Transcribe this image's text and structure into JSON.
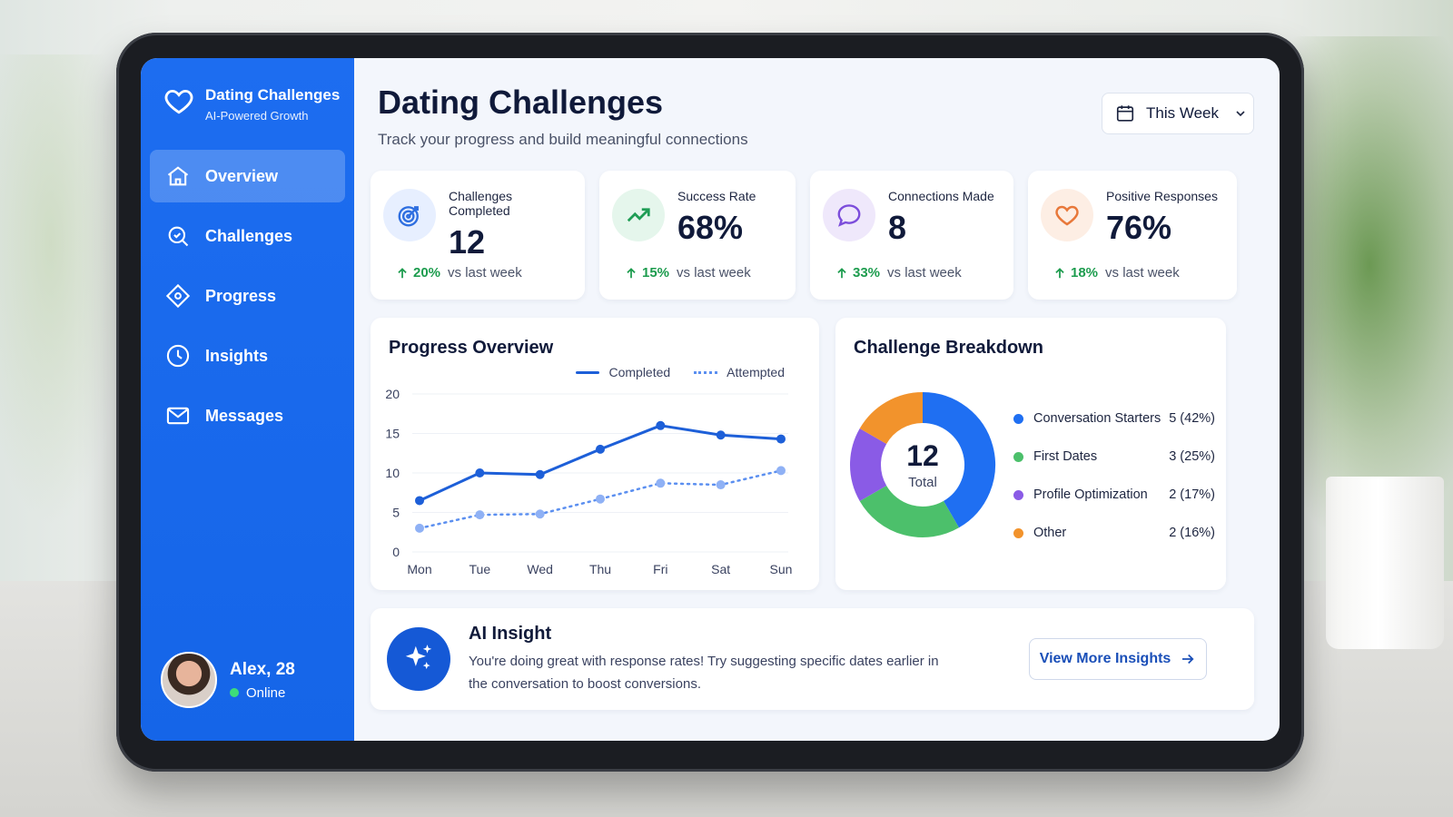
{
  "brand": {
    "title": "Dating Challenges",
    "subtitle": "AI-Powered Growth",
    "icon": "heart-icon"
  },
  "nav": [
    {
      "label": "Overview",
      "icon": "home-icon",
      "active": true
    },
    {
      "label": "Challenges",
      "icon": "search-icon",
      "active": false
    },
    {
      "label": "Progress",
      "icon": "diamond-icon",
      "active": false
    },
    {
      "label": "Insights",
      "icon": "clock-icon",
      "active": false
    },
    {
      "label": "Messages",
      "icon": "mail-icon",
      "active": false
    }
  ],
  "user": {
    "name": "Alex, 28",
    "status": "Online"
  },
  "header": {
    "title": "Dating Challenges",
    "subtitle": "Track your progress and build meaningful connections",
    "range": "This Week"
  },
  "stats": [
    {
      "label": "Challenges Completed",
      "value": "12",
      "change": "20%",
      "period": "vs last week",
      "icon": "target-icon",
      "color": "#2f6fe0",
      "bg": "#e7efff"
    },
    {
      "label": "Success Rate",
      "value": "68%",
      "change": "15%",
      "period": "vs last week",
      "icon": "trend-up-icon",
      "color": "#1f9d55",
      "bg": "#e5f6ec"
    },
    {
      "label": "Connections Made",
      "value": "8",
      "change": "33%",
      "period": "vs last week",
      "icon": "chat-bubble-icon",
      "color": "#7c4ddb",
      "bg": "#efe8fb"
    },
    {
      "label": "Positive Responses",
      "value": "76%",
      "change": "18%",
      "period": "vs last week",
      "icon": "heart-icon",
      "color": "#e8783a",
      "bg": "#fdeee4"
    }
  ],
  "progress": {
    "title": "Progress Overview",
    "legend_completed": "Completed",
    "legend_attempted": "Attempted"
  },
  "breakdown": {
    "title": "Challenge Breakdown",
    "total": "12",
    "total_label": "Total",
    "items": [
      {
        "name": "Conversation Starters",
        "value": "5 (42%)",
        "color": "#1f6ff2"
      },
      {
        "name": "First Dates",
        "value": "3 (25%)",
        "color": "#4cc06b"
      },
      {
        "name": "Profile Optimization",
        "value": "2 (17%)",
        "color": "#8a5be6"
      },
      {
        "name": "Other",
        "value": "2 (16%)",
        "color": "#f2932c"
      }
    ]
  },
  "insight": {
    "title": "AI Insight",
    "text": "You're doing great with response rates! Try suggesting specific dates earlier in the conversation to boost conversions.",
    "button": "View More Insights"
  },
  "chart_data": [
    {
      "type": "line",
      "title": "Progress Overview",
      "x": [
        "Mon",
        "Tue",
        "Wed",
        "Thu",
        "Fri",
        "Sat",
        "Sun"
      ],
      "ylim": [
        0,
        20
      ],
      "yticks": [
        0,
        5,
        10,
        15,
        20
      ],
      "grid": true,
      "legend": "top-right",
      "series": [
        {
          "name": "Completed",
          "values": [
            6.5,
            10,
            9.8,
            13,
            16,
            14.8,
            14.3
          ],
          "color": "#1d5fd8",
          "style": "solid"
        },
        {
          "name": "Attempted",
          "values": [
            3,
            4.7,
            4.8,
            6.7,
            8.7,
            8.5,
            10.3
          ],
          "color": "#5b8ff0",
          "style": "dotted"
        }
      ]
    },
    {
      "type": "pie",
      "title": "Challenge Breakdown",
      "categories": [
        "Conversation Starters",
        "First Dates",
        "Profile Optimization",
        "Other"
      ],
      "values": [
        5,
        3,
        2,
        2
      ],
      "colors": [
        "#1f6ff2",
        "#4cc06b",
        "#8a5be6",
        "#f2932c"
      ]
    }
  ]
}
